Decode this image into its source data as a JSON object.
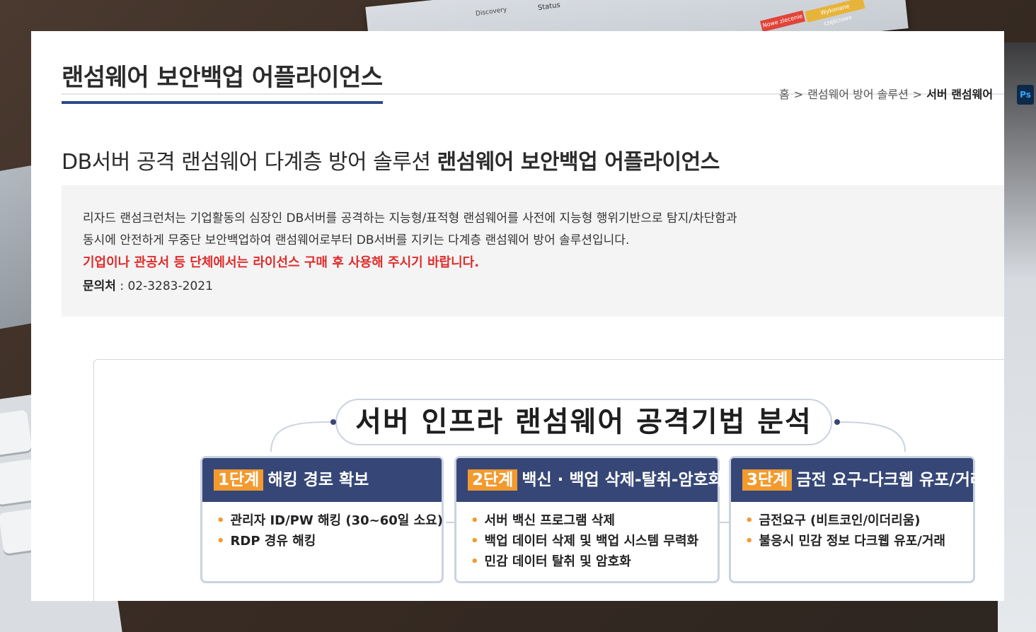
{
  "background": {
    "status_label": "Status",
    "discovery_label": "Discovery",
    "tag_red": "Nowe zlecenie",
    "tag_yellow": "Wykonane częściowo",
    "ps_icon_label": "Ps"
  },
  "header": {
    "title": "랜섬웨어 보안백업 어플라이언스",
    "breadcrumb": {
      "home": "홈",
      "sep": ">",
      "level1": "랜섬웨어 방어 솔루션",
      "current": "서버 랜섬웨어"
    }
  },
  "subtitle": {
    "prefix": "DB서버 공격 랜섬웨어 다계층 방어 솔루션 ",
    "emphasis": "랜섬웨어 보안백업 어플라이언스"
  },
  "info": {
    "line1": "리자드 랜섬크런처는 기업활동의 심장인 DB서버를 공격하는 지능형/표적형 랜섬웨어를 사전에 지능형 행위기반으로 탐지/차단함과",
    "line2": "동시에 안전하게 무중단 보안백업하여 랜섬웨어로부터 DB서버를 지키는 다계층 랜섬웨어 방어 솔루션입니다.",
    "warning": "기업이나 관공서 등 단체에서는 라이선스 구매 후 사용해 주시기 바랍니다.",
    "contact_label": "문의처",
    "contact_sep": " : ",
    "contact_value": "02-3283-2021"
  },
  "infographic": {
    "title": "서버 인프라 랜섬웨어 공격기법 분석",
    "stages": [
      {
        "num": "1단계",
        "title": "해킹 경로 확보",
        "items": [
          "관리자 ID/PW 해킹 (30~60일 소요)",
          "RDP 경유 해킹"
        ]
      },
      {
        "num": "2단계",
        "title": "백신 · 백업 삭제-탈취-암호화",
        "items": [
          "서버 백신 프로그램 삭제",
          "백업 데이터 삭제 및 백업 시스템 무력화",
          "민감 데이터 탈취 및 암호화"
        ]
      },
      {
        "num": "3단계",
        "title": "금전 요구-다크웹 유포/거래",
        "items": [
          "금전요구 (비트코인/이더리움)",
          "불응시 민감 정보 다크웹 유포/거래"
        ]
      }
    ],
    "bullet": "•",
    "colors": {
      "header_bg": "#364777",
      "accent": "#f29a2e",
      "border": "#cbd3e1"
    }
  }
}
